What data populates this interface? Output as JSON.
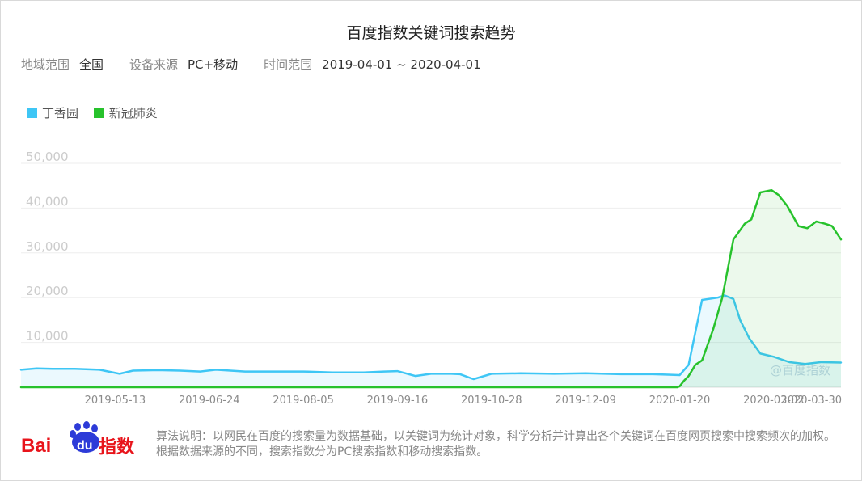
{
  "chart_data": {
    "type": "area",
    "title": "百度指数关键词搜索趋势",
    "filters": {
      "region_label": "地域范围",
      "region_value": "全国",
      "device_label": "设备来源",
      "device_value": "PC+移动",
      "time_label": "时间范围",
      "time_value": "2019-04-01 ~ 2020-04-01"
    },
    "ylim": [
      0,
      50000
    ],
    "y_ticks": [
      "50,000",
      "40,000",
      "30,000",
      "20,000",
      "10,000"
    ],
    "y_tick_values": [
      50000,
      40000,
      30000,
      20000,
      10000
    ],
    "x_tick_labels": [
      "2019-05-13",
      "2019-06-24",
      "2019-08-05",
      "2019-09-16",
      "2019-10-28",
      "2019-12-09",
      "2020-01-20",
      "2020-03-02",
      "2020-03-30"
    ],
    "x_range": [
      "2019-04-01",
      "2020-04-01"
    ],
    "grid": true,
    "legend_position": "top-left",
    "series": [
      {
        "name": "丁香园",
        "color": "#3ec6f5",
        "x": [
          "2019-04-01",
          "2019-04-08",
          "2019-04-15",
          "2019-04-25",
          "2019-05-06",
          "2019-05-15",
          "2019-05-21",
          "2019-06-01",
          "2019-06-11",
          "2019-06-20",
          "2019-06-27",
          "2019-07-10",
          "2019-07-22",
          "2019-08-05",
          "2019-08-18",
          "2019-09-01",
          "2019-09-10",
          "2019-09-16",
          "2019-09-24",
          "2019-10-01",
          "2019-10-10",
          "2019-10-14",
          "2019-10-20",
          "2019-10-28",
          "2019-11-10",
          "2019-11-25",
          "2019-12-09",
          "2019-12-25",
          "2020-01-08",
          "2020-01-15",
          "2020-01-20",
          "2020-01-24",
          "2020-01-30",
          "2020-02-06",
          "2020-02-09",
          "2020-02-13",
          "2020-02-16",
          "2020-02-20",
          "2020-02-25",
          "2020-03-02",
          "2020-03-09",
          "2020-03-16",
          "2020-03-23",
          "2020-04-01"
        ],
        "values": [
          3900,
          4200,
          4100,
          4100,
          3900,
          3000,
          3700,
          3800,
          3700,
          3500,
          3900,
          3500,
          3500,
          3500,
          3300,
          3300,
          3500,
          3600,
          2500,
          3000,
          3000,
          2900,
          1800,
          3000,
          3100,
          3000,
          3100,
          2900,
          2900,
          2800,
          2700,
          5000,
          19500,
          20000,
          20500,
          19700,
          15000,
          11000,
          7500,
          6800,
          5600,
          5200,
          5600,
          5500
        ]
      },
      {
        "name": "新冠肺炎",
        "color": "#27c22c",
        "x": [
          "2019-04-01",
          "2020-01-19",
          "2020-01-20",
          "2020-01-22",
          "2020-01-24",
          "2020-01-27",
          "2020-01-30",
          "2020-02-04",
          "2020-02-08",
          "2020-02-13",
          "2020-02-18",
          "2020-02-21",
          "2020-02-25",
          "2020-03-01",
          "2020-03-04",
          "2020-03-08",
          "2020-03-13",
          "2020-03-17",
          "2020-03-21",
          "2020-03-25",
          "2020-03-28",
          "2020-04-01"
        ],
        "values": [
          0,
          0,
          200,
          1500,
          2500,
          5000,
          6000,
          13000,
          20000,
          33000,
          36500,
          37500,
          43500,
          44000,
          43000,
          40500,
          36000,
          35500,
          37000,
          36500,
          36000,
          33000
        ]
      }
    ]
  },
  "watermark": "@百度指数",
  "footer": {
    "logo_text_bai": "Bai",
    "logo_text_du": "du",
    "logo_text_index": "指数",
    "description": "算法说明：以网民在百度的搜索量为数据基础，以关键词为统计对象，科学分析并计算出各个关键词在百度网页搜索中搜索频次的加权。根据数据来源的不同，搜索指数分为PC搜索指数和移动搜索指数。"
  }
}
